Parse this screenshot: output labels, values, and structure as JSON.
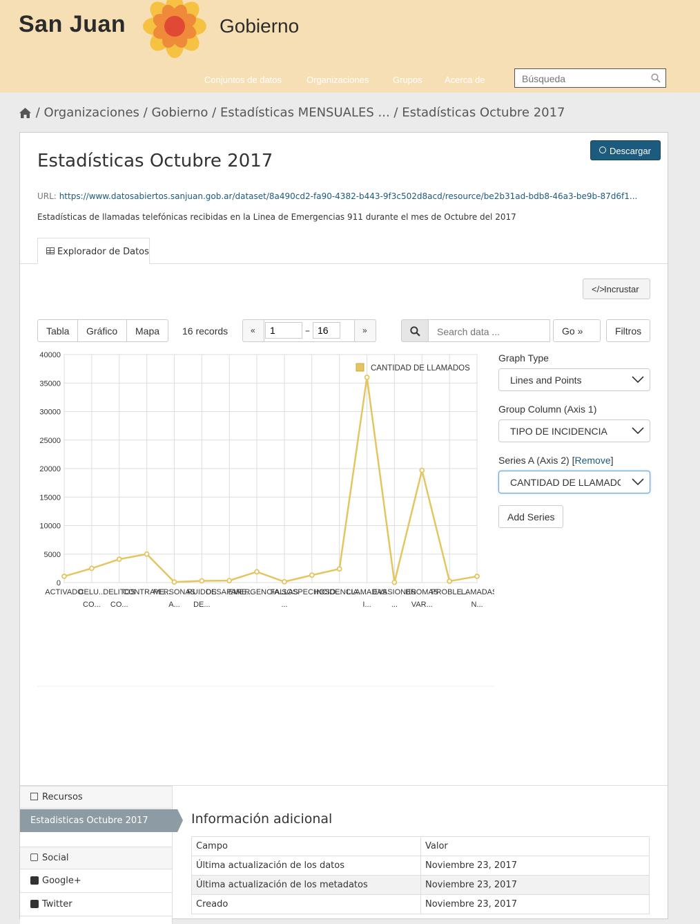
{
  "header": {
    "brand_left": "San Juan",
    "brand_right": "Gobierno",
    "nav": [
      "Conjuntos de datos",
      "Organizaciones",
      "Grupos",
      "Acerca de"
    ],
    "search_placeholder": "Búsqueda"
  },
  "breadcrumb": [
    "Organizaciones",
    "Gobierno",
    "Estadísticas MENSUALES ...",
    "Estadísticas Octubre 2017"
  ],
  "resource": {
    "download_label": "Descargar",
    "title": "Estadísticas Octubre 2017",
    "url_label": "URL:",
    "url": "https://www.datosabiertos.sanjuan.gob.ar/dataset/8a490cd2-fa90-4382-b443-9f3c502d8acd/resource/be2b31ad-bdb8-46a3-be9b-87d6f1...",
    "description": "Estadísticas de llamadas telefónicas recibidas en la Linea de Emergencias 911 durante el mes de Octubre del 2017",
    "tab_label": "Explorador de Datos",
    "embed_label": "Incrustar"
  },
  "toolbar": {
    "views": [
      "Tabla",
      "Gráfico",
      "Mapa"
    ],
    "records": "16 records",
    "prev": "«",
    "from": "1",
    "dash": "–",
    "to": "16",
    "next": "»",
    "search_placeholder": "Search data ...",
    "go_label": "Go »",
    "filters_label": "Filtros"
  },
  "editor": {
    "graph_type_label": "Graph Type",
    "graph_type_value": "Lines and Points",
    "group_column_label": "Group Column (Axis 1)",
    "group_column_value": "TIPO DE INCIDENCIA",
    "series_label": "Series A (Axis 2) [",
    "remove_label": "Remove",
    "series_label_end": "]",
    "series_value": "CANTIDAD DE LLAMADC",
    "add_series_label": "Add Series"
  },
  "chart_data": {
    "type": "line",
    "title": "",
    "xlabel": "",
    "ylabel": "",
    "ylim": [
      0,
      40000
    ],
    "yticks": [
      0,
      5000,
      10000,
      15000,
      20000,
      25000,
      30000,
      35000,
      40000
    ],
    "legend_position": "top-right",
    "color": "#e5c55f",
    "categories": [
      [
        "ACTIVADO"
      ],
      [
        "CELU...",
        "CO..."
      ],
      [
        "DELITOS",
        "CO..."
      ],
      [
        "CONTRAVE..."
      ],
      [
        "PERSONAS",
        "A..."
      ],
      [
        "RUIDOS",
        "DE..."
      ],
      [
        "DESAPARE..."
      ],
      [
        "EMERGENCIA..."
      ],
      [
        "FALLAS",
        "..."
      ],
      [
        "SOSPECHOSO..."
      ],
      [
        "INCIDENCIA..."
      ],
      [
        "LLAMADAS",
        "I..."
      ],
      [
        "EVASIONES",
        "..."
      ],
      [
        "BROMAS",
        "VAR..."
      ],
      [
        "PROBLE..."
      ],
      [
        "LLAMADAS",
        "N..."
      ]
    ],
    "series": [
      {
        "name": "CANTIDAD DE LLAMADOS",
        "values": [
          1100,
          2500,
          4100,
          5000,
          100,
          300,
          350,
          1900,
          150,
          1300,
          2400,
          36000,
          50,
          19700,
          250,
          1100
        ]
      }
    ]
  },
  "sidebar": {
    "resources_label": "Recursos",
    "active_resource": "Estadisticas Octubre 2017",
    "social_label": "Social",
    "items": [
      "Google+",
      "Twitter"
    ]
  },
  "info": {
    "title": "Información adicional",
    "headers": [
      "Campo",
      "Valor"
    ],
    "rows": [
      [
        "Última actualización de los datos",
        "Noviembre 23, 2017"
      ],
      [
        "Última actualización de los metadatos",
        "Noviembre 23, 2017"
      ],
      [
        "Creado",
        "Noviembre 23, 2017"
      ]
    ]
  }
}
